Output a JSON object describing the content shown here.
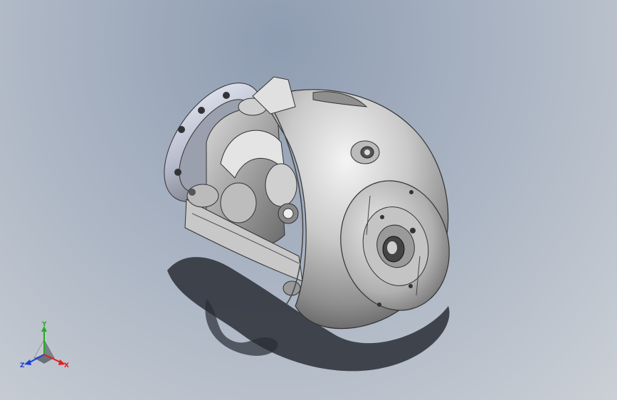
{
  "viewport": {
    "background_top": "#8f9db2",
    "background_bottom": "#cbd0d6"
  },
  "model": {
    "name_icon": "spherical-camera-housing-icon",
    "shell_color": "#d6d6d6",
    "shadow_color": "#2a2e36"
  },
  "triad": {
    "x_label": "X",
    "y_label": "Y",
    "z_label": "Z",
    "x_color": "#e02020",
    "y_color": "#20b020",
    "z_color": "#2040d0"
  }
}
